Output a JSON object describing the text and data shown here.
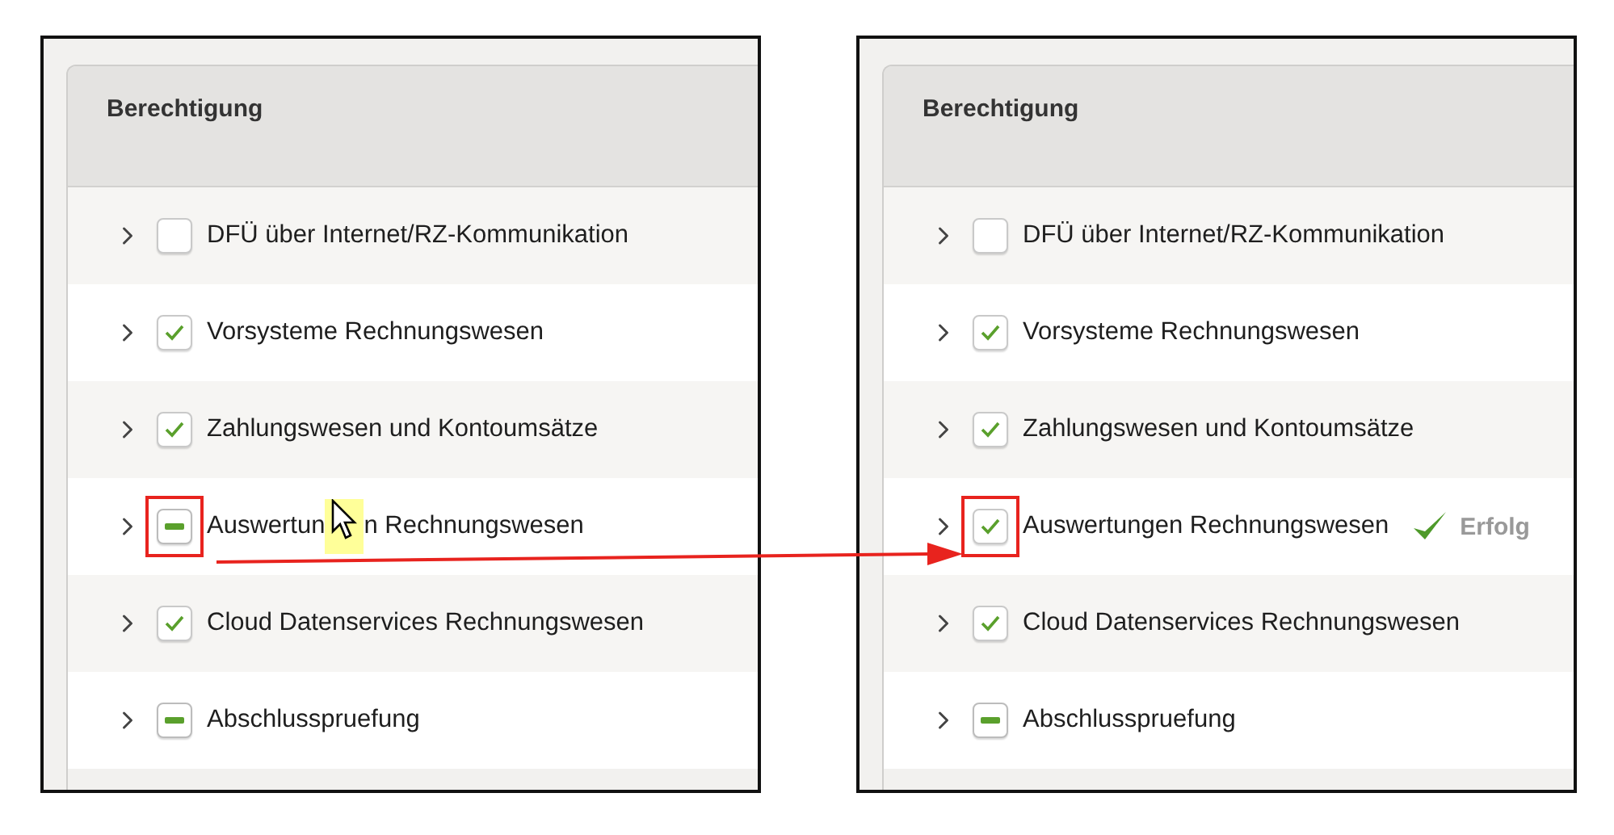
{
  "panels": [
    {
      "header": "Berechtigung",
      "items": [
        {
          "label": "DFÜ über Internet/RZ-Kommunikation",
          "checked": false,
          "partial": false,
          "annotated": false
        },
        {
          "label": "Vorsysteme Rechnungswesen",
          "checked": true,
          "partial": false,
          "annotated": false
        },
        {
          "label": "Zahlungswesen und Kontoumsätze",
          "checked": true,
          "partial": false,
          "annotated": false
        },
        {
          "label": "Auswertun",
          "label_after": "n Rechnungswesen",
          "cursor": true,
          "checked": false,
          "partial": true,
          "annotated": true
        },
        {
          "label": "Cloud Datenservices Rechnungswesen",
          "checked": true,
          "partial": false,
          "annotated": false
        },
        {
          "label": "Abschlusspruefung",
          "checked": false,
          "partial": true,
          "annotated": false
        }
      ]
    },
    {
      "header": "Berechtigung",
      "items": [
        {
          "label": "DFÜ über Internet/RZ-Kommunikation",
          "checked": false,
          "partial": false,
          "annotated": false
        },
        {
          "label": "Vorsysteme Rechnungswesen",
          "checked": true,
          "partial": false,
          "annotated": false
        },
        {
          "label": "Zahlungswesen und Kontoumsätze",
          "checked": true,
          "partial": false,
          "annotated": false
        },
        {
          "label": "Auswertungen Rechnungswesen",
          "checked": true,
          "partial": false,
          "annotated": true,
          "status": "Erfolg"
        },
        {
          "label": "Cloud Datenservices Rechnungswesen",
          "checked": true,
          "partial": false,
          "annotated": false
        },
        {
          "label": "Abschlusspruefung",
          "checked": false,
          "partial": true,
          "annotated": false
        }
      ]
    }
  ]
}
